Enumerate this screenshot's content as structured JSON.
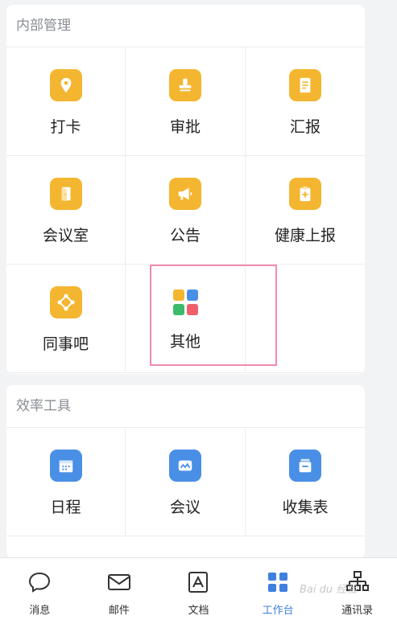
{
  "section1": {
    "title": "内部管理",
    "items": [
      {
        "label": "打卡",
        "icon": "location-pin-icon"
      },
      {
        "label": "审批",
        "icon": "stamp-icon"
      },
      {
        "label": "汇报",
        "icon": "report-doc-icon"
      },
      {
        "label": "会议室",
        "icon": "door-icon"
      },
      {
        "label": "公告",
        "icon": "megaphone-icon"
      },
      {
        "label": "健康上报",
        "icon": "clipboard-plus-icon"
      },
      {
        "label": "同事吧",
        "icon": "diamond-nodes-icon"
      },
      {
        "label": "其他",
        "icon": "apps-grid-icon"
      }
    ]
  },
  "section2": {
    "title": "效率工具",
    "items": [
      {
        "label": "日程",
        "icon": "calendar-icon"
      },
      {
        "label": "会议",
        "icon": "video-meeting-icon"
      },
      {
        "label": "收集表",
        "icon": "collect-form-icon"
      }
    ]
  },
  "tabbar": {
    "items": [
      {
        "label": "消息",
        "icon": "chat-bubble-icon",
        "active": false
      },
      {
        "label": "邮件",
        "icon": "mail-icon",
        "active": false
      },
      {
        "label": "文档",
        "icon": "document-icon",
        "active": false
      },
      {
        "label": "工作台",
        "icon": "workbench-grid-icon",
        "active": true
      },
      {
        "label": "通讯录",
        "icon": "org-chart-icon",
        "active": false
      }
    ]
  },
  "watermark": "Bai du 经验",
  "colors": {
    "accent": "#3f7fe0",
    "orange": "#f4b630",
    "blue": "#4a8fe6",
    "highlight": "#f28bb0"
  }
}
